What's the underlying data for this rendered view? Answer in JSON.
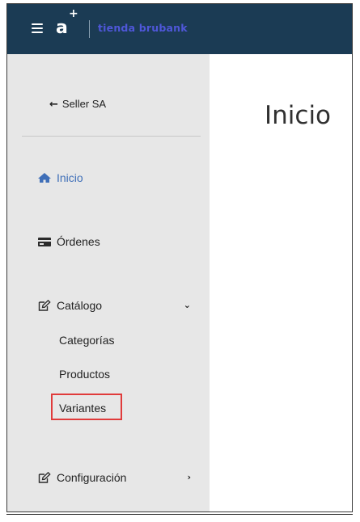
{
  "header": {
    "logo_text": "a",
    "logo_plus": "+",
    "brand": "tienda brubank",
    "colors": {
      "topbar": "#1b3b54",
      "brand": "#4f57d9"
    },
    "menu_icon": "hamburger-icon"
  },
  "sidebar": {
    "back_label": "Seller SA",
    "back_icon": "arrow-left-icon",
    "items": [
      {
        "label": "Inicio",
        "icon": "home-icon",
        "active": true
      },
      {
        "label": "Órdenes",
        "icon": "card-icon"
      },
      {
        "label": "Catálogo",
        "icon": "edit-icon",
        "expanded": true
      },
      {
        "label": "Configuración",
        "icon": "edit-icon",
        "expanded": false
      }
    ],
    "catalog_children": [
      {
        "label": "Categorías"
      },
      {
        "label": "Productos"
      },
      {
        "label": "Variantes",
        "highlighted": true
      }
    ],
    "colors": {
      "active": "#3f6fb8",
      "highlight": "#e03b3b",
      "background": "#e7e7e7"
    }
  },
  "main": {
    "title": "Inicio"
  }
}
